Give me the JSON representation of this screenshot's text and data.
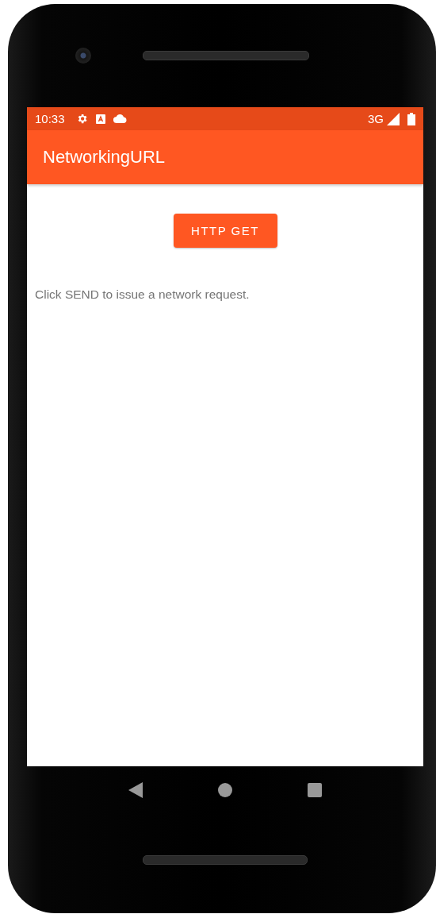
{
  "status_bar": {
    "time": "10:33",
    "network": "3G"
  },
  "app_bar": {
    "title": "NetworkingURL"
  },
  "button": {
    "label": "HTTP GET"
  },
  "message": "Click SEND to issue a network request."
}
